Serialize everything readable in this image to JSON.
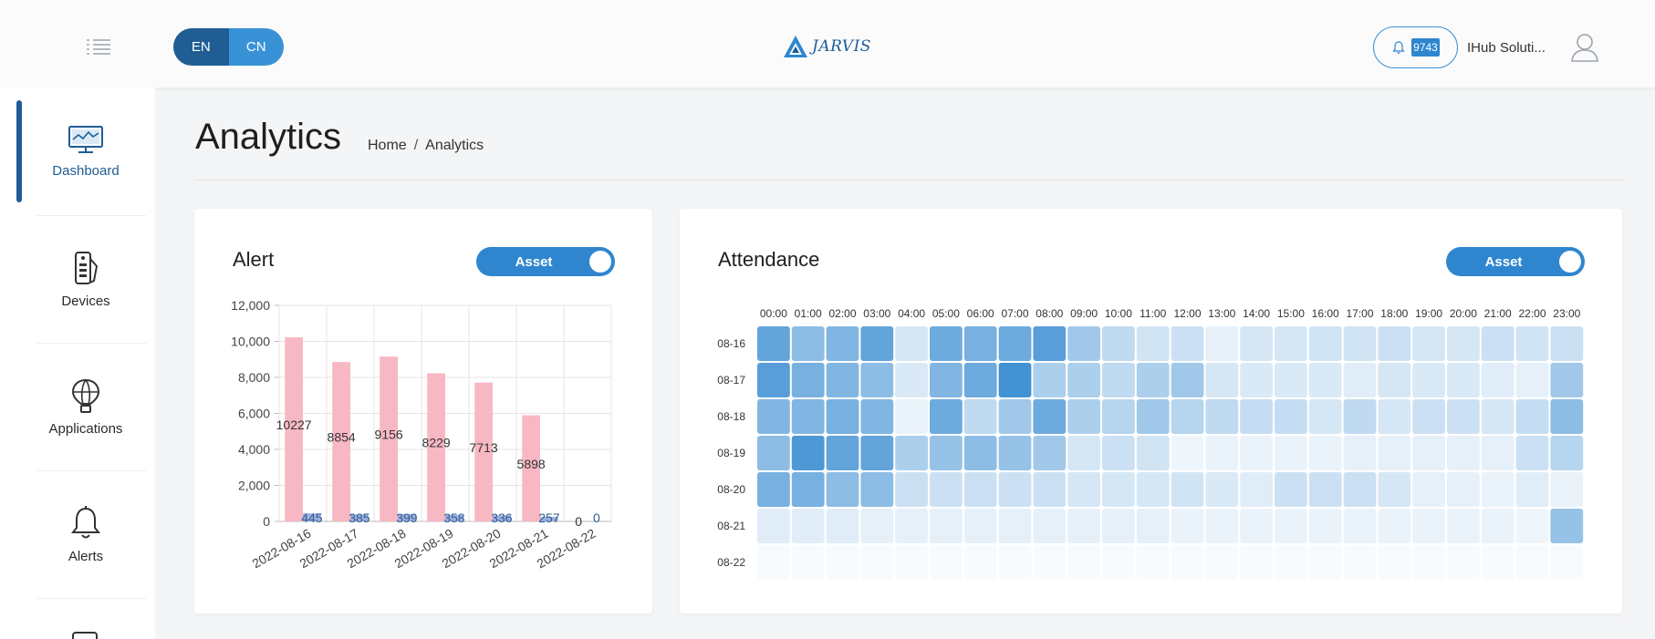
{
  "header": {
    "lang_options": [
      "EN",
      "CN"
    ],
    "logo_text": "JARVIS",
    "notification_count": "9743",
    "user_name": "IHub Soluti..."
  },
  "sidebar": {
    "items": [
      {
        "label": "Dashboard",
        "icon": "monitor-chart-icon"
      },
      {
        "label": "Devices",
        "icon": "devices-icon"
      },
      {
        "label": "Applications",
        "icon": "air-balloon-icon"
      },
      {
        "label": "Alerts",
        "icon": "bell-icon"
      }
    ]
  },
  "page": {
    "title": "Analytics",
    "breadcrumb": [
      "Home",
      "Analytics"
    ],
    "breadcrumb_sep": "/"
  },
  "alert_card": {
    "title": "Alert",
    "toggle_label": "Asset"
  },
  "attendance_card": {
    "title": "Attendance",
    "toggle_label": "Asset"
  },
  "colors": {
    "accent": "#2f86cf",
    "accent_dark": "#1f5d94",
    "bar_pink": "#f7b8c4",
    "heat_base": "#2f86cf"
  },
  "chart_data": [
    {
      "type": "bar",
      "categories": [
        "2022-08-16",
        "2022-08-17",
        "2022-08-18",
        "2022-08-19",
        "2022-08-20",
        "2022-08-21",
        "2022-08-22"
      ],
      "series": [
        {
          "values": [
            10227,
            8854,
            9156,
            8229,
            7713,
            5898,
            0
          ],
          "color": "#f7b8c4",
          "label_color": "#333333"
        },
        {
          "values": [
            445,
            385,
            399,
            358,
            336,
            257,
            0
          ],
          "color": "#9fb0df",
          "label_color": "#2f5f93"
        }
      ],
      "y_ticks": [
        "0",
        "2,000",
        "4,000",
        "6,000",
        "8,000",
        "10,000",
        "12,000"
      ],
      "ylim": [
        0,
        12000
      ],
      "grid": true
    },
    {
      "type": "heatmap",
      "x": [
        "00:00",
        "01:00",
        "02:00",
        "03:00",
        "04:00",
        "05:00",
        "06:00",
        "07:00",
        "08:00",
        "09:00",
        "10:00",
        "11:00",
        "12:00",
        "13:00",
        "14:00",
        "15:00",
        "16:00",
        "17:00",
        "18:00",
        "19:00",
        "20:00",
        "21:00",
        "22:00",
        "23:00"
      ],
      "y": [
        "08-16",
        "08-17",
        "08-18",
        "08-19",
        "08-20",
        "08-21",
        "08-22"
      ],
      "values": [
        [
          0.75,
          0.55,
          0.6,
          0.75,
          0.2,
          0.7,
          0.65,
          0.7,
          0.8,
          0.45,
          0.3,
          0.22,
          0.25,
          0.12,
          0.2,
          0.2,
          0.22,
          0.22,
          0.25,
          0.2,
          0.2,
          0.25,
          0.22,
          0.25
        ],
        [
          0.8,
          0.65,
          0.6,
          0.55,
          0.18,
          0.6,
          0.7,
          0.9,
          0.4,
          0.4,
          0.3,
          0.4,
          0.45,
          0.2,
          0.18,
          0.18,
          0.18,
          0.15,
          0.2,
          0.18,
          0.18,
          0.15,
          0.12,
          0.45
        ],
        [
          0.6,
          0.6,
          0.65,
          0.6,
          0.1,
          0.7,
          0.3,
          0.45,
          0.7,
          0.4,
          0.35,
          0.45,
          0.35,
          0.3,
          0.28,
          0.28,
          0.2,
          0.3,
          0.2,
          0.25,
          0.25,
          0.2,
          0.28,
          0.55
        ],
        [
          0.55,
          0.85,
          0.75,
          0.75,
          0.4,
          0.5,
          0.55,
          0.5,
          0.45,
          0.2,
          0.25,
          0.22,
          0.08,
          0.1,
          0.1,
          0.1,
          0.1,
          0.12,
          0.12,
          0.12,
          0.12,
          0.12,
          0.25,
          0.35
        ],
        [
          0.65,
          0.65,
          0.55,
          0.55,
          0.25,
          0.25,
          0.25,
          0.25,
          0.25,
          0.2,
          0.2,
          0.2,
          0.22,
          0.18,
          0.15,
          0.25,
          0.25,
          0.25,
          0.2,
          0.12,
          0.12,
          0.1,
          0.15,
          0.1
        ],
        [
          0.15,
          0.15,
          0.15,
          0.12,
          0.12,
          0.12,
          0.12,
          0.12,
          0.12,
          0.12,
          0.12,
          0.12,
          0.1,
          0.1,
          0.1,
          0.1,
          0.1,
          0.1,
          0.1,
          0.1,
          0.1,
          0.1,
          0.08,
          0.5
        ],
        [
          0.03,
          0.03,
          0.03,
          0.03,
          0.03,
          0.03,
          0.03,
          0.03,
          0.03,
          0.03,
          0.03,
          0.03,
          0.03,
          0.03,
          0.03,
          0.03,
          0.03,
          0.03,
          0.03,
          0.03,
          0.03,
          0.03,
          0.03,
          0.03
        ]
      ]
    }
  ]
}
